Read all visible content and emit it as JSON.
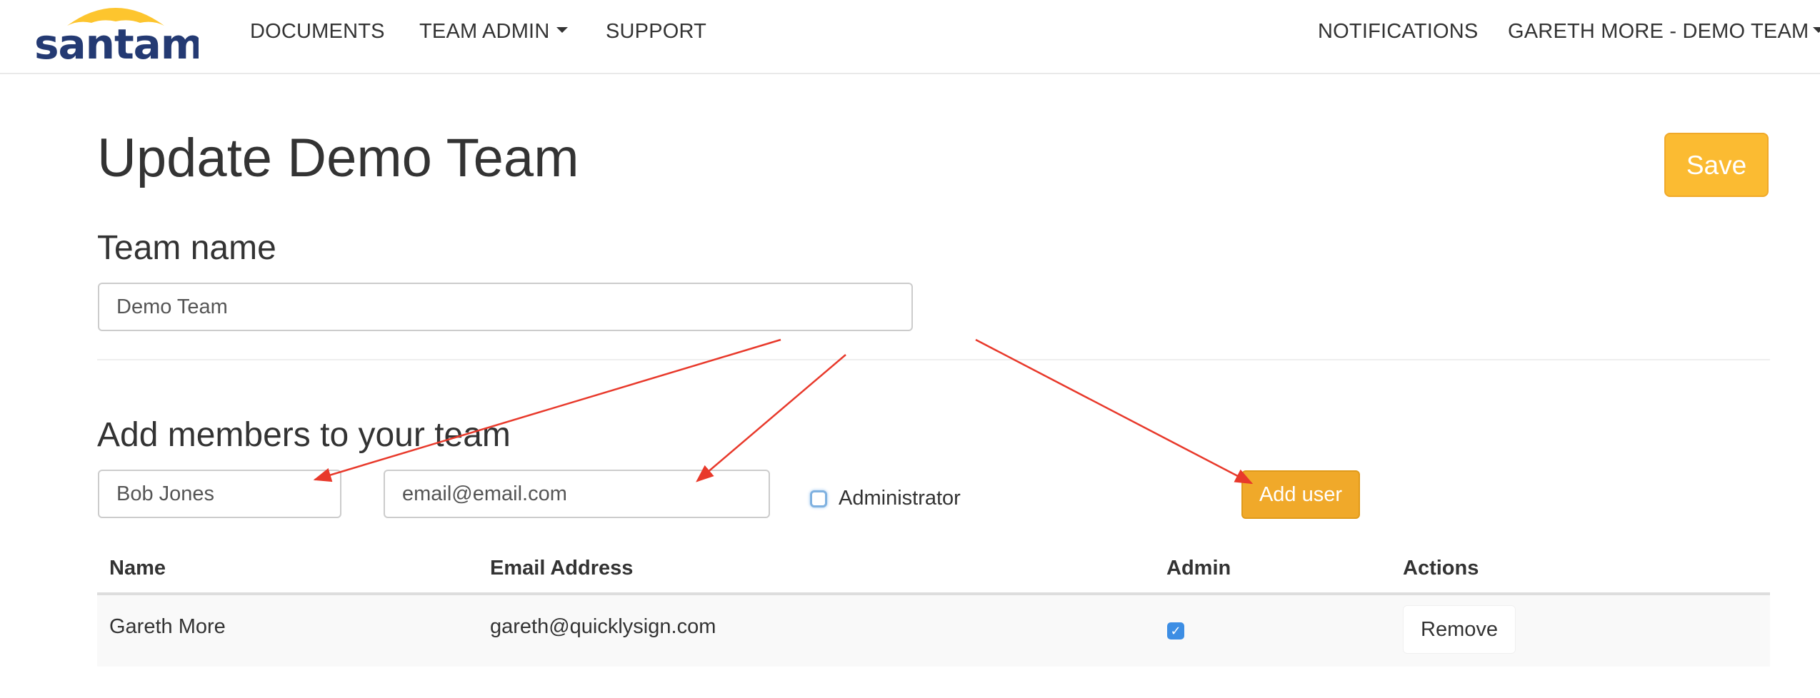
{
  "brand": {
    "name": "santam",
    "accent": "#fbbb32",
    "umbrella_color": "#fdc52e",
    "logo_text_color": "#243a73"
  },
  "nav": {
    "left": [
      {
        "label": "DOCUMENTS"
      },
      {
        "label": "TEAM ADMIN",
        "dropdown": true
      },
      {
        "label": "SUPPORT"
      }
    ],
    "notifications": "NOTIFICATIONS",
    "user": "GARETH MORE - DEMO TEAM"
  },
  "page": {
    "title": "Update Demo Team",
    "save_label": "Save"
  },
  "team_name": {
    "heading": "Team name",
    "value": "Demo Team"
  },
  "members": {
    "heading": "Add members to your team",
    "name_placeholder": "Bob Jones",
    "email_placeholder": "email@email.com",
    "admin_label": "Administrator",
    "admin_checked": false,
    "add_label": "Add user"
  },
  "table": {
    "headers": {
      "name": "Name",
      "email": "Email Address",
      "admin": "Admin",
      "actions": "Actions"
    },
    "rows": [
      {
        "name": "Gareth More",
        "email": "gareth@quicklysign.com",
        "admin": true,
        "action": "Remove"
      }
    ]
  },
  "annotation_color": "#e8392b"
}
